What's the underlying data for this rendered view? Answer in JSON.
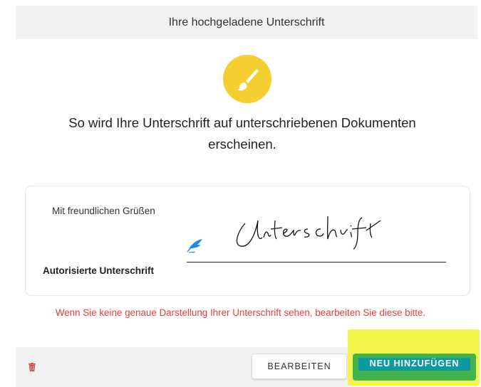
{
  "header": {
    "title": "Ihre hochgeladene Unterschrift"
  },
  "intro": {
    "description": "So wird Ihre Unterschrift auf unterschriebenen Dokumenten erscheinen."
  },
  "signature_card": {
    "closing": "Mit freundlichen Grüßen",
    "signature_text": "Unterschrift",
    "authorized_label": "Autorisierte Unterschrift"
  },
  "warning": {
    "text": "Wenn Sie keine genaue Darstellung Ihrer Unterschrift sehen, bearbeiten Sie diese bitte."
  },
  "actions": {
    "edit_label": "BEARBEITEN",
    "add_new_label": "NEU HINZUFÜGEN"
  },
  "colors": {
    "accent_yellow": "#f5cf2f",
    "warning_red": "#e53e3e",
    "button_green": "#42b24c",
    "button_teal": "#0e9aa0",
    "highlight": "#f4f54a",
    "quill_blue": "#1e88e5"
  },
  "icons": {
    "brush": "paintbrush-icon",
    "quill": "quill-icon",
    "trash": "trash-icon"
  }
}
